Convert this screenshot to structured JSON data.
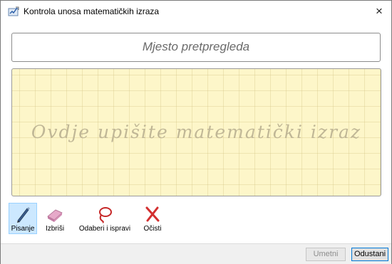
{
  "window": {
    "title": "Kontrola unosa matematičkih izraza",
    "close_glyph": "×"
  },
  "preview": {
    "placeholder": "Mjesto pretpregleda"
  },
  "writing_area": {
    "placeholder": "Ovdje upišite matematički izraz",
    "background_color": "#fdf6c9"
  },
  "toolbar": {
    "tools": [
      {
        "label": "Pisanje",
        "icon": "pen-icon",
        "active": true
      },
      {
        "label": "Izbriši",
        "icon": "eraser-icon",
        "active": false
      },
      {
        "label": "Odaberi i ispravi",
        "icon": "lasso-icon",
        "active": false
      },
      {
        "label": "Očisti",
        "icon": "clear-x-icon",
        "active": false
      }
    ]
  },
  "footer": {
    "insert_label": "Umetni",
    "cancel_label": "Odustani"
  }
}
